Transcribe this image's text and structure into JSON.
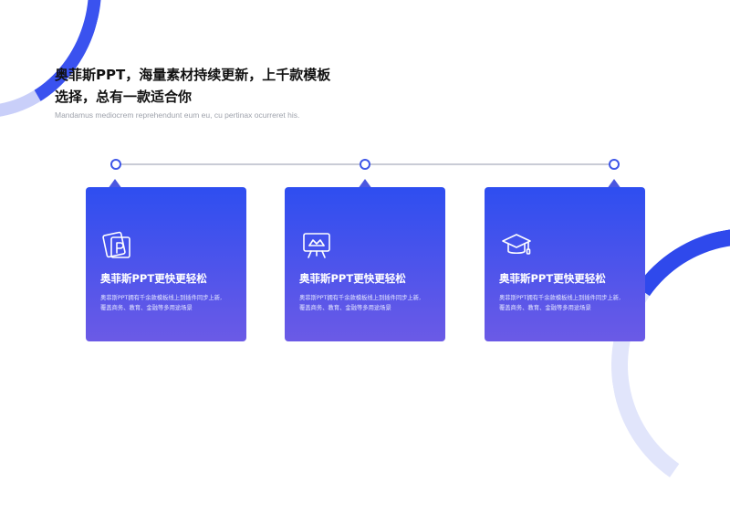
{
  "header": {
    "title_line1": "奥菲斯PPT，海量素材持续更新，上千款模板",
    "title_line2": "选择，总有一款适合你",
    "subtitle": "Mandamus mediocrem reprehendunt eum eu, cu pertinax ocurreret his."
  },
  "colors": {
    "accent": "#3a52ef",
    "card_gradient_top": "#2e4ef0",
    "card_gradient_bottom": "#6b5ae6",
    "timeline": "#c9ccd6"
  },
  "cards": [
    {
      "icon": "photo-p-icon",
      "title": "奥菲斯PPT更快更轻松",
      "desc_line1": "奥菲斯PPT拥有千余款模板线上到插件同步上新,",
      "desc_line2": "覆盖商务、教育、金融等多用途场景"
    },
    {
      "icon": "presentation-board-icon",
      "title": "奥菲斯PPT更快更轻松",
      "desc_line1": "奥菲斯PPT拥有千余款模板线上到插件同步上新,",
      "desc_line2": "覆盖商务、教育、金融等多用途场景"
    },
    {
      "icon": "graduation-cap-icon",
      "title": "奥菲斯PPT更快更轻松",
      "desc_line1": "奥菲斯PPT拥有千余款模板线上到插件同步上新,",
      "desc_line2": "覆盖商务、教育、金融等多用途场景"
    }
  ]
}
